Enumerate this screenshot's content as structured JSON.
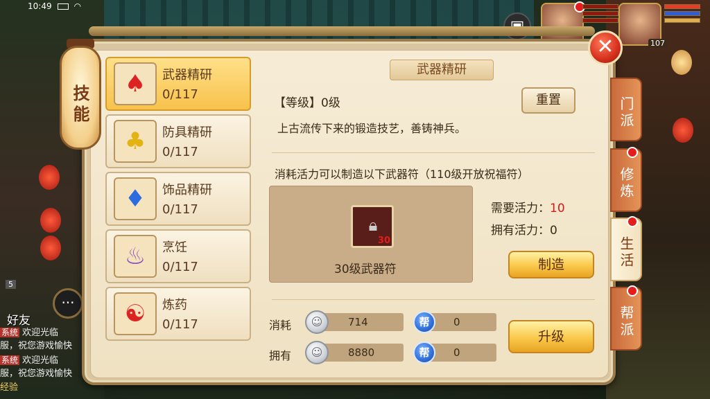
{
  "status_bar": {
    "time": "10:49"
  },
  "player": {
    "level": "107"
  },
  "chat": {
    "level_badge": "5",
    "friends_label": "好友",
    "lines": [
      {
        "tag": "系统",
        "text": "欢迎光临"
      },
      {
        "tag": "",
        "text": "服，祝您游戏愉快"
      },
      {
        "tag": "系统",
        "text": "欢迎光临"
      },
      {
        "tag": "",
        "text": "服，祝您游戏愉快"
      }
    ],
    "exp_label": "经验"
  },
  "panel": {
    "lantern_title": "技能",
    "skills": [
      {
        "name": "武器精研",
        "count": "0/117",
        "icon": "weapon-gourd-icon",
        "active": true
      },
      {
        "name": "防具精研",
        "count": "0/117",
        "icon": "armor-gourd-icon",
        "active": false
      },
      {
        "name": "饰品精研",
        "count": "0/117",
        "icon": "accessory-gourd-icon",
        "active": false
      },
      {
        "name": "烹饪",
        "count": "0/117",
        "icon": "cooking-pot-icon",
        "active": false
      },
      {
        "name": "炼药",
        "count": "0/117",
        "icon": "alchemy-cauldron-icon",
        "active": false
      }
    ],
    "detail": {
      "title": "武器精研",
      "level_text": "【等级】0级",
      "description": "上古流传下来的锻造技艺，善铸神兵。",
      "reset_label": "重置",
      "consume_text": "消耗活力可以制造以下武器符（110级开放祝福符）",
      "recipe": {
        "name": "30级武器符",
        "level_badge": "30"
      },
      "need_label": "需要活力：",
      "need_value": "10",
      "have_label": "拥有活力：",
      "have_value": "0",
      "make_label": "制造",
      "resources": {
        "consume_label": "消耗",
        "consume_silver": "714",
        "consume_bang": "0",
        "own_label": "拥有",
        "own_silver": "8880",
        "own_bang": "0",
        "bang_glyph": "帮"
      },
      "upgrade_label": "升级"
    },
    "tabs": [
      {
        "label": "门派",
        "active": false,
        "dot": false
      },
      {
        "label": "修炼",
        "active": false,
        "dot": true
      },
      {
        "label": "生活",
        "active": true,
        "dot": true
      },
      {
        "label": "帮派",
        "active": false,
        "dot": true
      }
    ]
  },
  "colors": {
    "accent_gold": "#f9c84a",
    "alert_red": "#e51c1c",
    "panel_bg": "#f6ecd6"
  }
}
